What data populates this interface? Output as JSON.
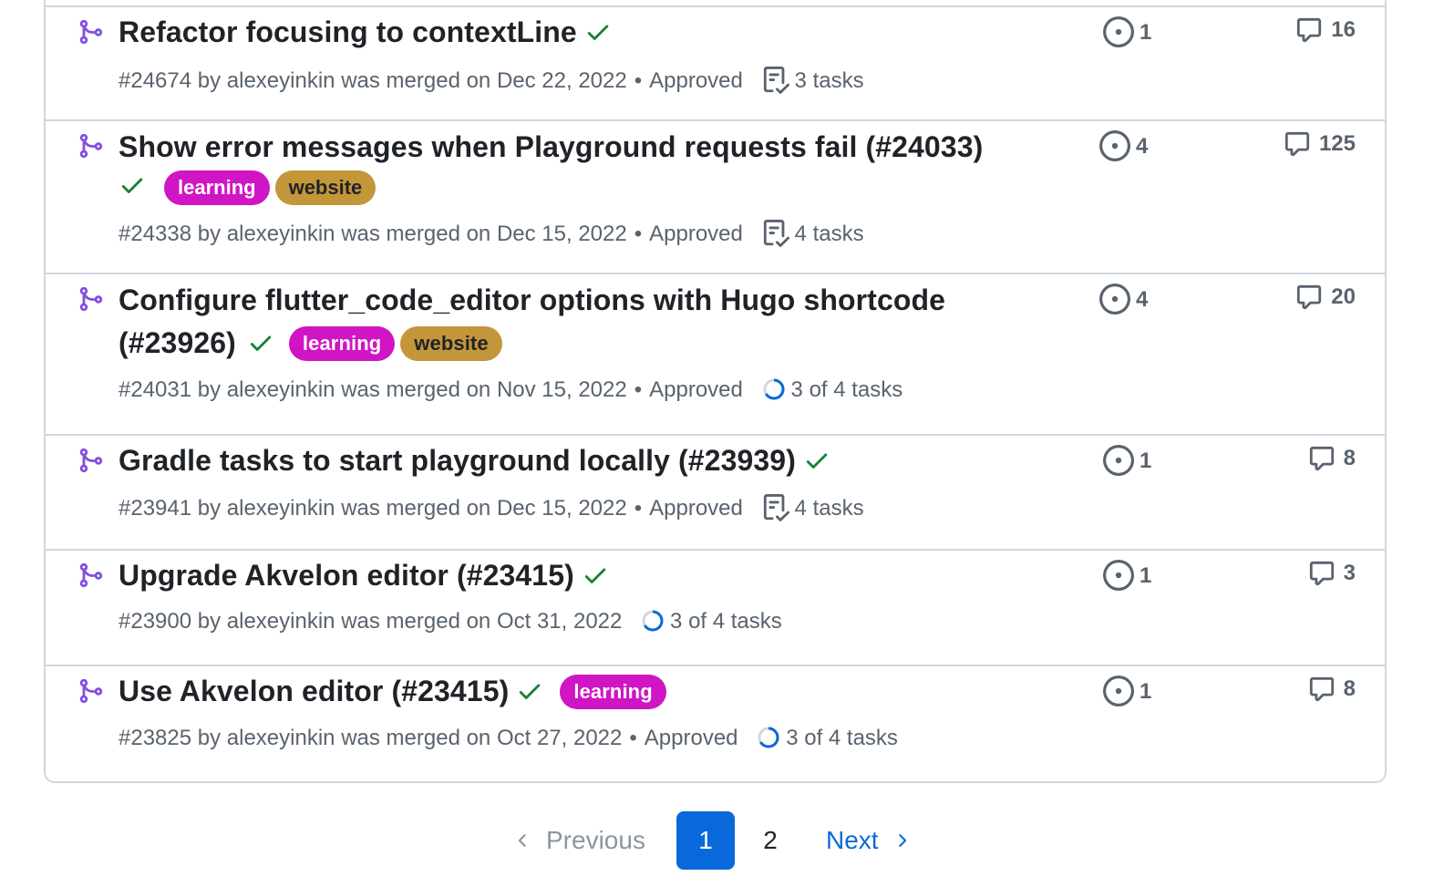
{
  "pulls": [
    {
      "title": "Refactor focusing to contextLine",
      "meta_number": "#24674",
      "meta_author": "alexeyinkin",
      "meta_merged": "was merged on Dec 22, 2022",
      "review": "Approved",
      "tasks": "3 tasks",
      "linked_issues": "1",
      "comments": "16"
    },
    {
      "title": "Show error messages when Playground requests fail (#24033)",
      "labels": [
        "learning",
        "website"
      ],
      "meta_number": "#24338",
      "meta_author": "alexeyinkin",
      "meta_merged": "was merged on Dec 15, 2022",
      "review": "Approved",
      "tasks": "4 tasks",
      "linked_issues": "4",
      "comments": "125"
    },
    {
      "title_line1": "Configure flutter_code_editor options with Hugo shortcode",
      "title_line2": "(#23926)",
      "labels": [
        "learning",
        "website"
      ],
      "meta_number": "#24031",
      "meta_author": "alexeyinkin",
      "meta_merged": "was merged on Nov 15, 2022",
      "review": "Approved",
      "tasks": "3 of 4 tasks",
      "linked_issues": "4",
      "comments": "20"
    },
    {
      "title": "Gradle tasks to start playground locally (#23939)",
      "meta_number": "#23941",
      "meta_author": "alexeyinkin",
      "meta_merged": "was merged on Dec 15, 2022",
      "review": "Approved",
      "tasks": "4 tasks",
      "linked_issues": "1",
      "comments": "8"
    },
    {
      "title": "Upgrade Akvelon editor (#23415)",
      "meta_number": "#23900",
      "meta_author": "alexeyinkin",
      "meta_merged": "was merged on Oct 31, 2022",
      "tasks": "3 of 4 tasks",
      "linked_issues": "1",
      "comments": "3"
    },
    {
      "title": "Use Akvelon editor (#23415)",
      "labels": [
        "learning"
      ],
      "meta_number": "#23825",
      "meta_author": "alexeyinkin",
      "meta_merged": "was merged on Oct 27, 2022",
      "review": "Approved",
      "tasks": "3 of 4 tasks",
      "linked_issues": "1",
      "comments": "8"
    }
  ],
  "pagination": {
    "previous": "Previous",
    "current": "1",
    "page2": "2",
    "next": "Next"
  },
  "colors": {
    "merged_purple": "#8250df",
    "check_green": "#1a7f37",
    "label_learning": "#d015c4",
    "label_website": "#c4963a",
    "accent_blue": "#0969da"
  },
  "icons": {
    "merged": "git-merge-icon",
    "status": "check-icon",
    "tasks_complete": "tasklist-icon",
    "tasks_progress": "progress-circle-icon",
    "linked_issue": "issue-opened-icon",
    "comment": "comment-icon",
    "prev": "chevron-left-icon",
    "next": "chevron-right-icon"
  }
}
